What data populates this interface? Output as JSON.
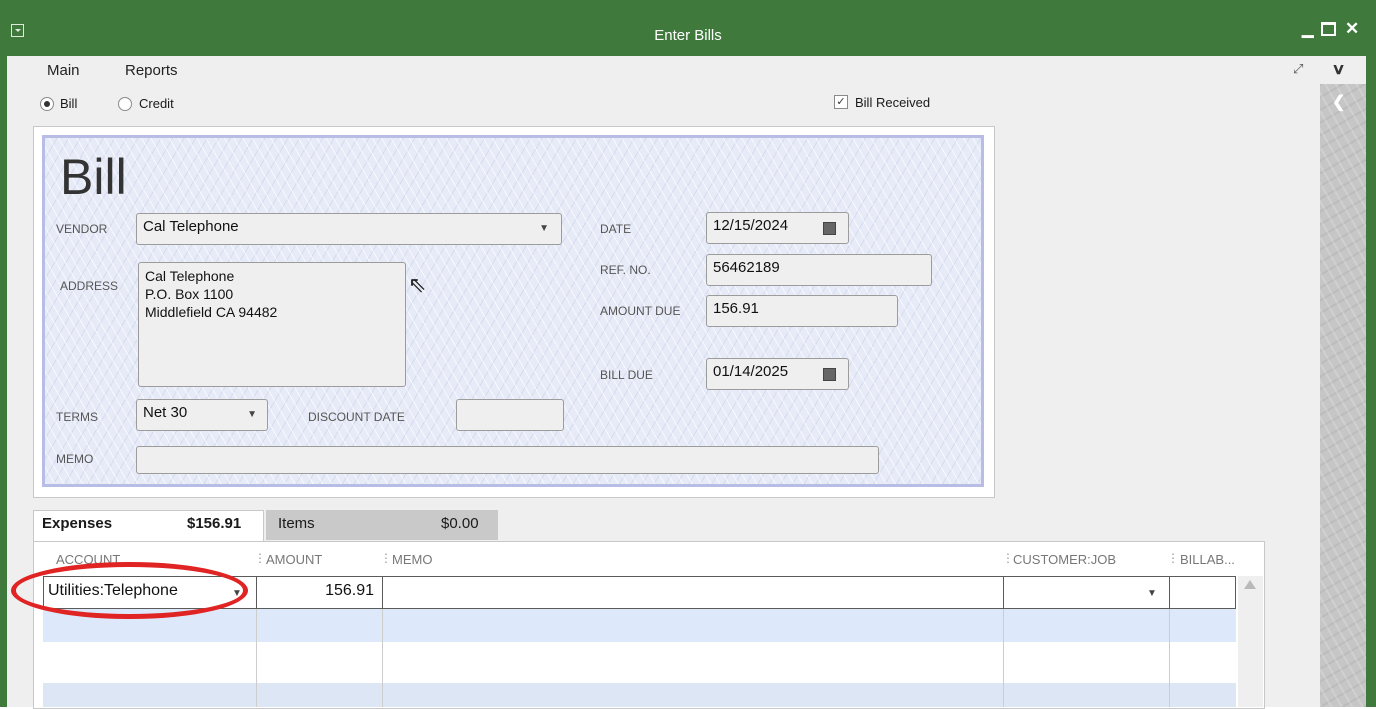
{
  "window": {
    "title": "Enter Bills"
  },
  "menu": {
    "main": "Main",
    "reports": "Reports"
  },
  "type": {
    "bill_label": "Bill",
    "credit_label": "Credit",
    "bill_received_label": "Bill Received",
    "bill_received_checked": true
  },
  "bill": {
    "heading": "Bill",
    "vendor_label": "VENDOR",
    "vendor": "Cal Telephone",
    "address_label": "ADDRESS",
    "address_line1": "Cal Telephone",
    "address_line2": "P.O. Box 1100",
    "address_line3": "Middlefield CA 94482",
    "terms_label": "TERMS",
    "terms": "Net 30",
    "discount_date_label": "DISCOUNT DATE",
    "discount_date": "",
    "memo_label": "MEMO",
    "memo": "",
    "date_label": "DATE",
    "date": "12/15/2024",
    "ref_label": "REF. NO.",
    "ref_no": "56462189",
    "amount_due_label": "AMOUNT DUE",
    "amount_due": "156.91",
    "bill_due_label": "BILL DUE",
    "bill_due": "01/14/2025"
  },
  "tabs": {
    "expenses_label": "Expenses",
    "expenses_total": "$156.91",
    "items_label": "Items",
    "items_total": "$0.00"
  },
  "grid": {
    "columns": {
      "account": "ACCOUNT",
      "amount": "AMOUNT",
      "memo": "MEMO",
      "customer_job": "CUSTOMER:JOB",
      "billable": "BILLAB..."
    },
    "rows": [
      {
        "account": "Utilities:Telephone",
        "amount": "156.91",
        "memo": "",
        "customer_job": "",
        "billable": ""
      }
    ]
  },
  "colors": {
    "title_bar": "#3f7a3c",
    "highlight_oval": "#e02323",
    "check_background": "#e7ebf7"
  }
}
